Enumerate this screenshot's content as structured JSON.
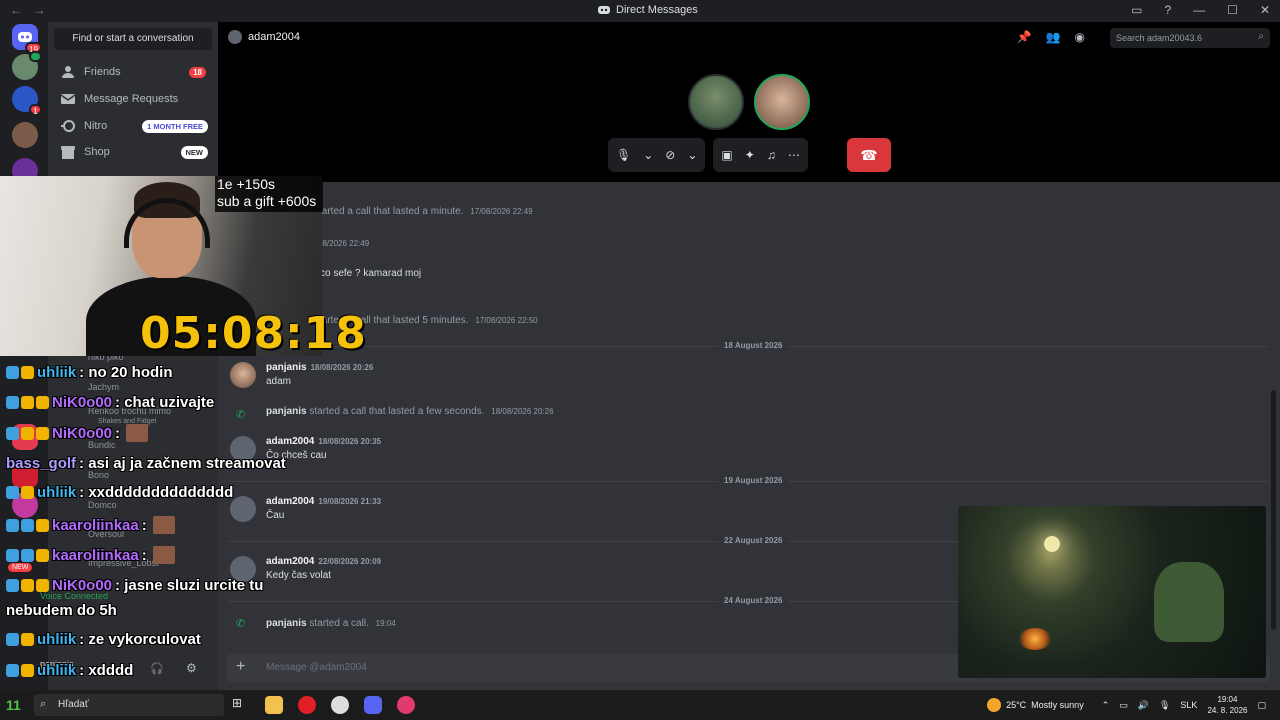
{
  "window": {
    "title": "Direct Messages",
    "nav_back": "←",
    "nav_forward": "→",
    "controls": [
      "▭",
      "?",
      "—",
      "☐",
      "✕"
    ]
  },
  "rail": {
    "home_badge": "19",
    "server_badges": [
      "1",
      "1"
    ]
  },
  "sidebar": {
    "find_label": "Find or start a conversation",
    "items": [
      {
        "label": "Friends",
        "icon": "friends-icon",
        "count": "18"
      },
      {
        "label": "Message Requests",
        "icon": "envelope-icon"
      },
      {
        "label": "Nitro",
        "icon": "nitro-icon",
        "tag": "1 MONTH FREE"
      },
      {
        "label": "Shop",
        "icon": "shop-icon",
        "tag": "NEW"
      }
    ]
  },
  "header": {
    "username": "adam2004",
    "search_placeholder": "Search adam20043.6"
  },
  "messages": {
    "sys1": {
      "text": "started a call that lasted a minute.",
      "ts": "17/08/2026 22:49"
    },
    "msg_partial": {
      "ts": "08/2026 22:49",
      "body": "co sefe ? kamarad moj"
    },
    "sys2": {
      "text": "started a call that lasted 5 minutes.",
      "ts": "17/08/2026 22:50"
    },
    "divider1": "18 August 2026",
    "m1": {
      "name": "panjanis",
      "ts": "18/08/2026 20:26",
      "body": "adam"
    },
    "sys3": {
      "name": "panjanis",
      "text": "started a call that lasted a few seconds.",
      "ts": "18/08/2026 20:26"
    },
    "m2": {
      "name": "adam2004",
      "ts": "18/08/2026 20:35",
      "body": "Čo chceš cau"
    },
    "divider2": "19 August 2026",
    "m3": {
      "name": "adam2004",
      "ts": "19/08/2026 21:33",
      "body": "Čau"
    },
    "divider3": "22 August 2026",
    "m4": {
      "name": "adam2004",
      "ts": "22/08/2026 20:09",
      "body": "Kedy čas volat"
    },
    "divider4": "24 August 2026",
    "sys4": {
      "name": "panjanis",
      "text": "started a call.",
      "ts": "19:04"
    }
  },
  "input": {
    "placeholder": "Message @adam2004",
    "plus": "+"
  },
  "stream": {
    "timer": "05:08:18",
    "overlay_line1": "1e +150s",
    "overlay_line2": "sub a gift +600s"
  },
  "chat_overlay": [
    {
      "user": "uhliik",
      "text": ": no 20 hodin",
      "color": "#3fb6f2"
    },
    {
      "user": "NiK0o00",
      "text": ": chat uzivajte",
      "color": "#b36bff"
    },
    {
      "user": "NiK0o00",
      "text": ":",
      "color": "#b36bff"
    },
    {
      "user": "bass_golf",
      "text": ": asi aj ja začnem streamovat",
      "color": "#b09cff"
    },
    {
      "user": "uhliik",
      "text": ": xxdddddddddddddd",
      "color": "#3fb6f2"
    },
    {
      "user": "kaaroliinkaa",
      "text": ":",
      "color": "#b36bff"
    },
    {
      "user": "kaaroliinkaa",
      "text": ":",
      "color": "#b36bff"
    },
    {
      "user": "NiK0o00",
      "text": ": jasne sluzi urcite tu",
      "color": "#b36bff"
    },
    {
      "user": "",
      "text": "nebudem do 5h",
      "color": "#fff"
    },
    {
      "user": "uhliik",
      "text": ": ze vykorculovat",
      "color": "#3fb6f2"
    },
    {
      "user": "uhliik",
      "text": ": xdddd",
      "color": "#3fb6f2"
    }
  ],
  "ghost_text": {
    "niko": "niko piko",
    "jachym": "Jachym",
    "renkoo": "Renkoo trochu mimo",
    "shakes": "Shakes and Fidget",
    "bundic": "Bundic",
    "bono": "Bono",
    "domco": "Domco",
    "oversoul": "Oversoul",
    "impressive": "Impressive_Lobst",
    "voice": "Voice Connected",
    "panjanis": "panjanis",
    "new_badge": "NEW"
  },
  "taskbar": {
    "search": "Hľadať",
    "temp": "25°C",
    "weather": "Mostly sunny",
    "lang": "SLK",
    "time": "19:04",
    "date": "24. 8. 2026",
    "start_num": "11"
  }
}
